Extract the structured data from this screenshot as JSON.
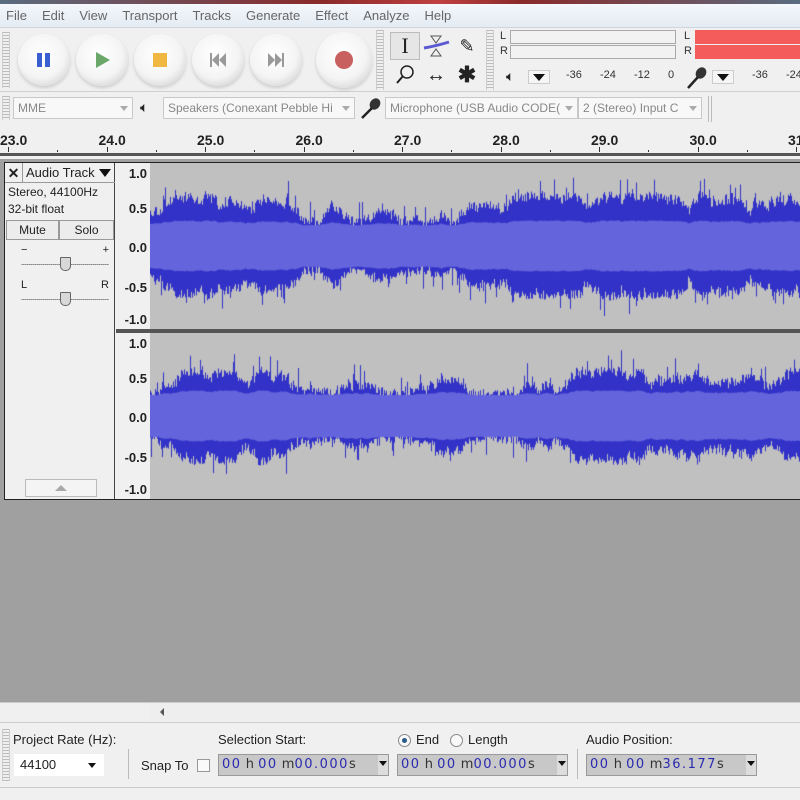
{
  "menu": [
    "File",
    "Edit",
    "View",
    "Transport",
    "Tracks",
    "Generate",
    "Effect",
    "Analyze",
    "Help"
  ],
  "transport": {
    "pause": "pause-icon",
    "play": "play-icon",
    "stop": "stop-icon",
    "skip_start": "skip-to-start-icon",
    "skip_end": "skip-to-end-icon",
    "record": "record-icon",
    "colors": {
      "pause": "#3a5fd0",
      "play": "#6aa86a",
      "stop": "#f0b840",
      "skip": "#9a9a9a",
      "record": "#c86060"
    }
  },
  "tools": {
    "selection": "I",
    "envelope": "envelope-tool-icon",
    "draw": "✎",
    "zoom": "⌕",
    "timeshift": "↔",
    "multi": "✱"
  },
  "meters": {
    "playback": {
      "L": "L",
      "R": "R",
      "scale": [
        "-36",
        "-24",
        "-12",
        "0"
      ]
    },
    "record": {
      "L": "L",
      "R": "R",
      "scale": [
        "-36",
        "-24"
      ],
      "color": "#f45c5c"
    }
  },
  "devices": {
    "host": "MME",
    "output": "Speakers (Conexant Pebble Hi",
    "input": "Microphone (USB Audio CODE(",
    "channels": "2 (Stereo) Input C"
  },
  "ruler": {
    "labels": [
      "23.0",
      "24.0",
      "25.0",
      "26.0",
      "27.0",
      "28.0",
      "29.0",
      "30.0",
      "31"
    ]
  },
  "track": {
    "name": "Audio Track",
    "info1": "Stereo, 44100Hz",
    "info2": "32-bit float",
    "mute": "Mute",
    "solo": "Solo",
    "gain_minus": "−",
    "gain_plus": "+",
    "pan_left": "L",
    "pan_right": "R",
    "gain_value": 0.5,
    "pan_value": 0.5,
    "amplitude_labels": [
      "1.0",
      "0.5",
      "0.0",
      "-0.5",
      "-1.0"
    ],
    "wave_color": "#3232c8",
    "wave_rms_color": "#6464dc"
  },
  "selection_toolbar": {
    "project_rate_label": "Project Rate (Hz):",
    "project_rate": "44100",
    "snap_to": "Snap To",
    "selection_start_label": "Selection Start:",
    "end_label": "End",
    "length_label": "Length",
    "audio_position_label": "Audio Position:",
    "selection_start": {
      "h": "00",
      "m": "00",
      "s": "00.000"
    },
    "end": {
      "h": "00",
      "m": "00",
      "s": "00.000"
    },
    "audio_position": {
      "h": "00",
      "m": "00",
      "s": "36.177"
    },
    "unit_h": "h",
    "unit_m": "m",
    "unit_s": "s"
  }
}
